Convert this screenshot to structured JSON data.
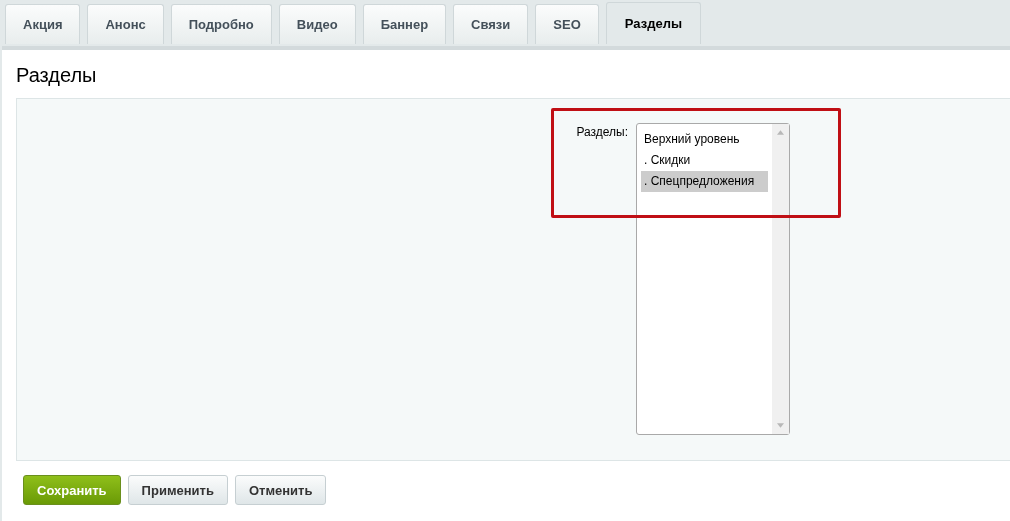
{
  "tabs": [
    {
      "label": "Акция",
      "selected": false
    },
    {
      "label": "Анонс",
      "selected": false
    },
    {
      "label": "Подробно",
      "selected": false
    },
    {
      "label": "Видео",
      "selected": false
    },
    {
      "label": "Баннер",
      "selected": false
    },
    {
      "label": "Связи",
      "selected": false
    },
    {
      "label": "SEO",
      "selected": false
    },
    {
      "label": "Разделы",
      "selected": true
    }
  ],
  "section_title": "Разделы",
  "field": {
    "label": "Разделы:",
    "options": [
      {
        "label": "Верхний уровень",
        "selected": false
      },
      {
        "label": ". Скидки",
        "selected": false
      },
      {
        "label": ". Спецпредложения",
        "selected": true
      }
    ]
  },
  "highlight": true,
  "buttons": [
    {
      "label": "Сохранить",
      "kind": "primary"
    },
    {
      "label": "Применить",
      "kind": "default"
    },
    {
      "label": "Отменить",
      "kind": "default"
    }
  ]
}
